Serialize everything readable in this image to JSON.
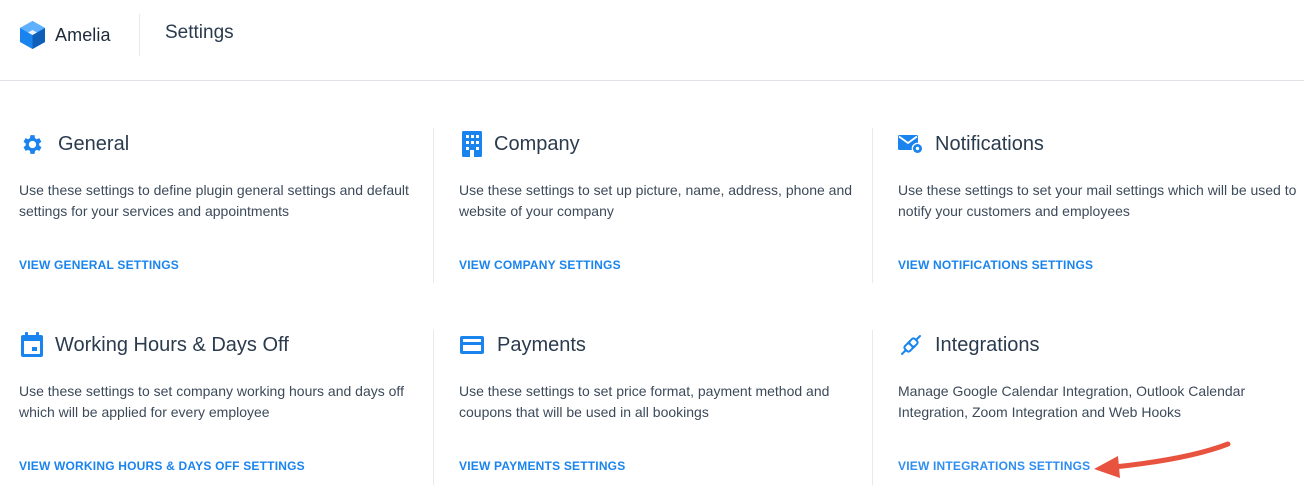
{
  "app": {
    "name": "Amelia",
    "page_title": "Settings",
    "accent_color": "#1a84ee"
  },
  "cards": [
    {
      "title": "General",
      "icon": "gear-icon",
      "description": "Use these settings to define plugin general settings and default settings for your services and appointments",
      "link": "VIEW GENERAL SETTINGS"
    },
    {
      "title": "Company",
      "icon": "building-icon",
      "description": "Use these settings to set up picture, name, address, phone and website of your company",
      "link": "VIEW COMPANY SETTINGS"
    },
    {
      "title": "Notifications",
      "icon": "envelope-gear-icon",
      "description": "Use these settings to set your mail settings which will be used to notify your customers and employees",
      "link": "VIEW NOTIFICATIONS SETTINGS"
    },
    {
      "title": "Working Hours & Days Off",
      "icon": "calendar-icon",
      "description": "Use these settings to set company working hours and days off which will be applied for every employee",
      "link": "VIEW WORKING HOURS & DAYS OFF SETTINGS"
    },
    {
      "title": "Payments",
      "icon": "credit-card-icon",
      "description": "Use these settings to set price format, payment method and coupons that will be used in all bookings",
      "link": "VIEW PAYMENTS SETTINGS"
    },
    {
      "title": "Integrations",
      "icon": "plug-icon",
      "description": "Manage Google Calendar Integration, Outlook Calendar Integration, Zoom Integration and Web Hooks",
      "link": "VIEW INTEGRATIONS SETTINGS"
    }
  ],
  "annotation": {
    "arrow_color": "#e8533f"
  }
}
